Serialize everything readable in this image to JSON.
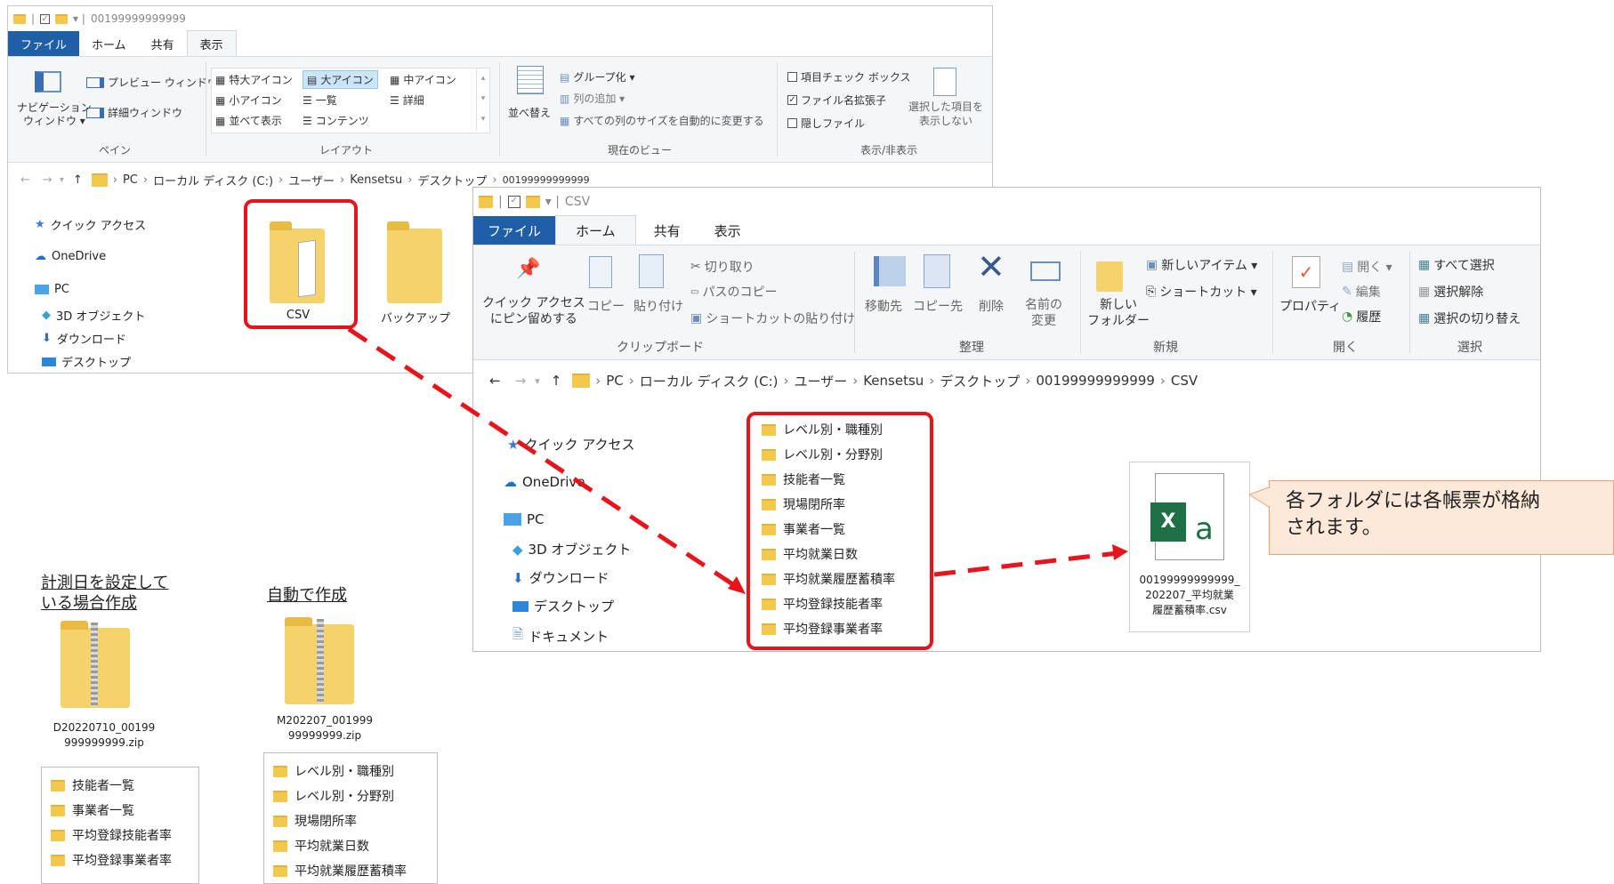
{
  "window1": {
    "title": "00199999999999",
    "tabs": [
      "ファイル",
      "ホーム",
      "共有",
      "表示"
    ],
    "ribbon": {
      "panes_group": {
        "nav_pane": "ナビゲーション\nウィンドウ ▾",
        "preview_pane": "プレビュー ウィンドウ",
        "details_pane": "詳細ウィンドウ",
        "label": "ペイン"
      },
      "layout_group": {
        "items": [
          "特大アイコン",
          "大アイコン",
          "中アイコン",
          "小アイコン",
          "一覧",
          "詳細",
          "並べて表示",
          "コンテンツ"
        ],
        "label": "レイアウト"
      },
      "view_group": {
        "sort": "並べ替え",
        "group_by": "グループ化 ▾",
        "add_column": "列の追加 ▾",
        "fit_columns": "すべての列のサイズを自動的に変更する",
        "label": "現在のビュー"
      },
      "show_group": {
        "item_checkbox": "項目チェック ボックス",
        "file_ext": "ファイル名拡張子",
        "hidden_files": "隠しファイル",
        "hide_selected": "選択した項目を\n表示しない",
        "label": "表示/非表示"
      }
    },
    "breadcrumb": [
      "PC",
      "ローカル ディスク (C:)",
      "ユーザー",
      "Kensetsu",
      "デスクトップ",
      "00199999999999"
    ],
    "nav": [
      "クイック アクセス",
      "OneDrive",
      "PC",
      "3D オブジェクト",
      "ダウンロード",
      "デスクトップ"
    ],
    "folders": [
      "CSV",
      "バックアップ"
    ]
  },
  "window2": {
    "title": "CSV",
    "tabs": [
      "ファイル",
      "ホーム",
      "共有",
      "表示"
    ],
    "ribbon": {
      "clipboard": {
        "pin": "クイック アクセス\nにピン留めする",
        "copy": "コピー",
        "paste": "貼り付け",
        "cut": "切り取り",
        "copy_path": "パスのコピー",
        "paste_shortcut": "ショートカットの貼り付け",
        "label": "クリップボード"
      },
      "organize": {
        "move_to": "移動先",
        "copy_to": "コピー先",
        "delete": "削除",
        "rename": "名前の\n変更",
        "label": "整理"
      },
      "new": {
        "new_folder": "新しい\nフォルダー",
        "new_item": "新しいアイテム ▾",
        "shortcut": "ショートカット ▾",
        "label": "新規"
      },
      "open": {
        "properties": "プロパティ",
        "open": "開く ▾",
        "edit": "編集",
        "history": "履歴",
        "label": "開く"
      },
      "select": {
        "select_all": "すべて選択",
        "select_none": "選択解除",
        "invert": "選択の切り替え",
        "label": "選択"
      }
    },
    "breadcrumb": [
      "PC",
      "ローカル ディスク (C:)",
      "ユーザー",
      "Kensetsu",
      "デスクトップ",
      "00199999999999",
      "CSV"
    ],
    "nav": [
      "クイック アクセス",
      "OneDrive",
      "PC",
      "3D オブジェクト",
      "ダウンロード",
      "デスクトップ",
      "ドキュメント"
    ],
    "folders": [
      "レベル別・職種別",
      "レベル別・分野別",
      "技能者一覧",
      "現場閉所率",
      "事業者一覧",
      "平均就業日数",
      "平均就業履歴蓄積率",
      "平均登録技能者率",
      "平均登録事業者率"
    ],
    "csv_file": "00199999999999_\n202207_平均就業\n履歴蓄積率.csv",
    "excel_letter": "X",
    "excel_a": "a"
  },
  "callout": "各フォルダには各帳票が格納\nされます。",
  "zip1": {
    "caption": "計測日を設定して\nいる場合作成",
    "filename": "D20220710_00199\n999999999.zip",
    "items": [
      "技能者一覧",
      "事業者一覧",
      "平均登録技能者率",
      "平均登録事業者率"
    ]
  },
  "zip2": {
    "caption": "自動で作成",
    "filename": "M202207_001999\n99999999.zip",
    "items": [
      "レベル別・職種別",
      "レベル別・分野別",
      "現場閉所率",
      "平均就業日数",
      "平均就業履歴蓄積率"
    ]
  },
  "colors": {
    "accent": "#1f5fa8",
    "highlight": "#e8141c",
    "folder": "#f5d26a",
    "callout_bg": "#fde9d9",
    "callout_border": "#f0a070",
    "excel": "#1e7145"
  }
}
